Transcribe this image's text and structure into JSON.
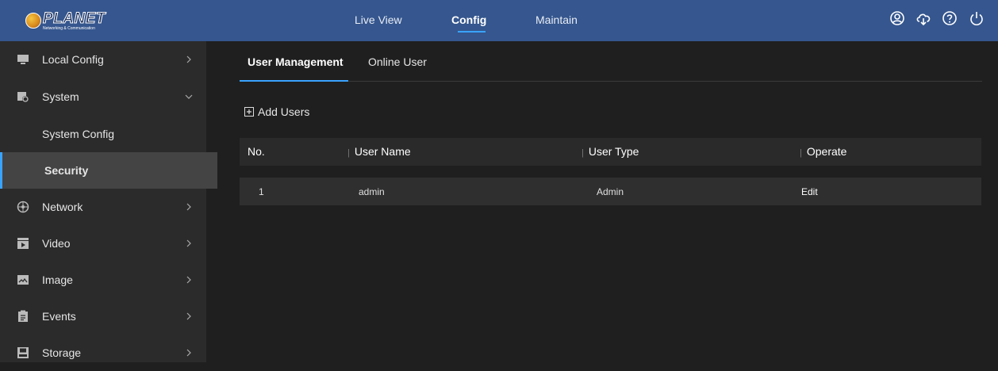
{
  "brand": {
    "name": "PLANET",
    "tagline": "Networking & Communication"
  },
  "topnav": {
    "items": [
      {
        "label": "Live View"
      },
      {
        "label": "Config"
      },
      {
        "label": "Maintain"
      }
    ],
    "active": "Config",
    "icons": [
      "user-icon",
      "cloud-download-icon",
      "help-icon",
      "power-icon"
    ]
  },
  "sidebar": {
    "items": [
      {
        "label": "Local Config",
        "icon": "monitor-icon"
      },
      {
        "label": "System",
        "icon": "system-icon",
        "expanded": true,
        "children": [
          {
            "label": "System Config"
          },
          {
            "label": "Security",
            "selected": true
          }
        ]
      },
      {
        "label": "Network",
        "icon": "network-icon"
      },
      {
        "label": "Video",
        "icon": "video-icon"
      },
      {
        "label": "Image",
        "icon": "image-icon"
      },
      {
        "label": "Events",
        "icon": "events-icon"
      },
      {
        "label": "Storage",
        "icon": "storage-icon"
      }
    ]
  },
  "main": {
    "tabs": [
      {
        "label": "User Management"
      },
      {
        "label": "Online User"
      }
    ],
    "active_tab": "User Management",
    "add_users_label": "Add Users",
    "table": {
      "columns": [
        "No.",
        "User Name",
        "User Type",
        "Operate"
      ],
      "rows": [
        {
          "no": "1",
          "user_name": "admin",
          "user_type": "Admin",
          "operate": "Edit"
        }
      ]
    }
  },
  "colors": {
    "header": "#35568e",
    "accent": "#3aa3ff",
    "sidebar": "#2b2b2b",
    "selected": "#444444",
    "background": "#1f1f1f"
  }
}
